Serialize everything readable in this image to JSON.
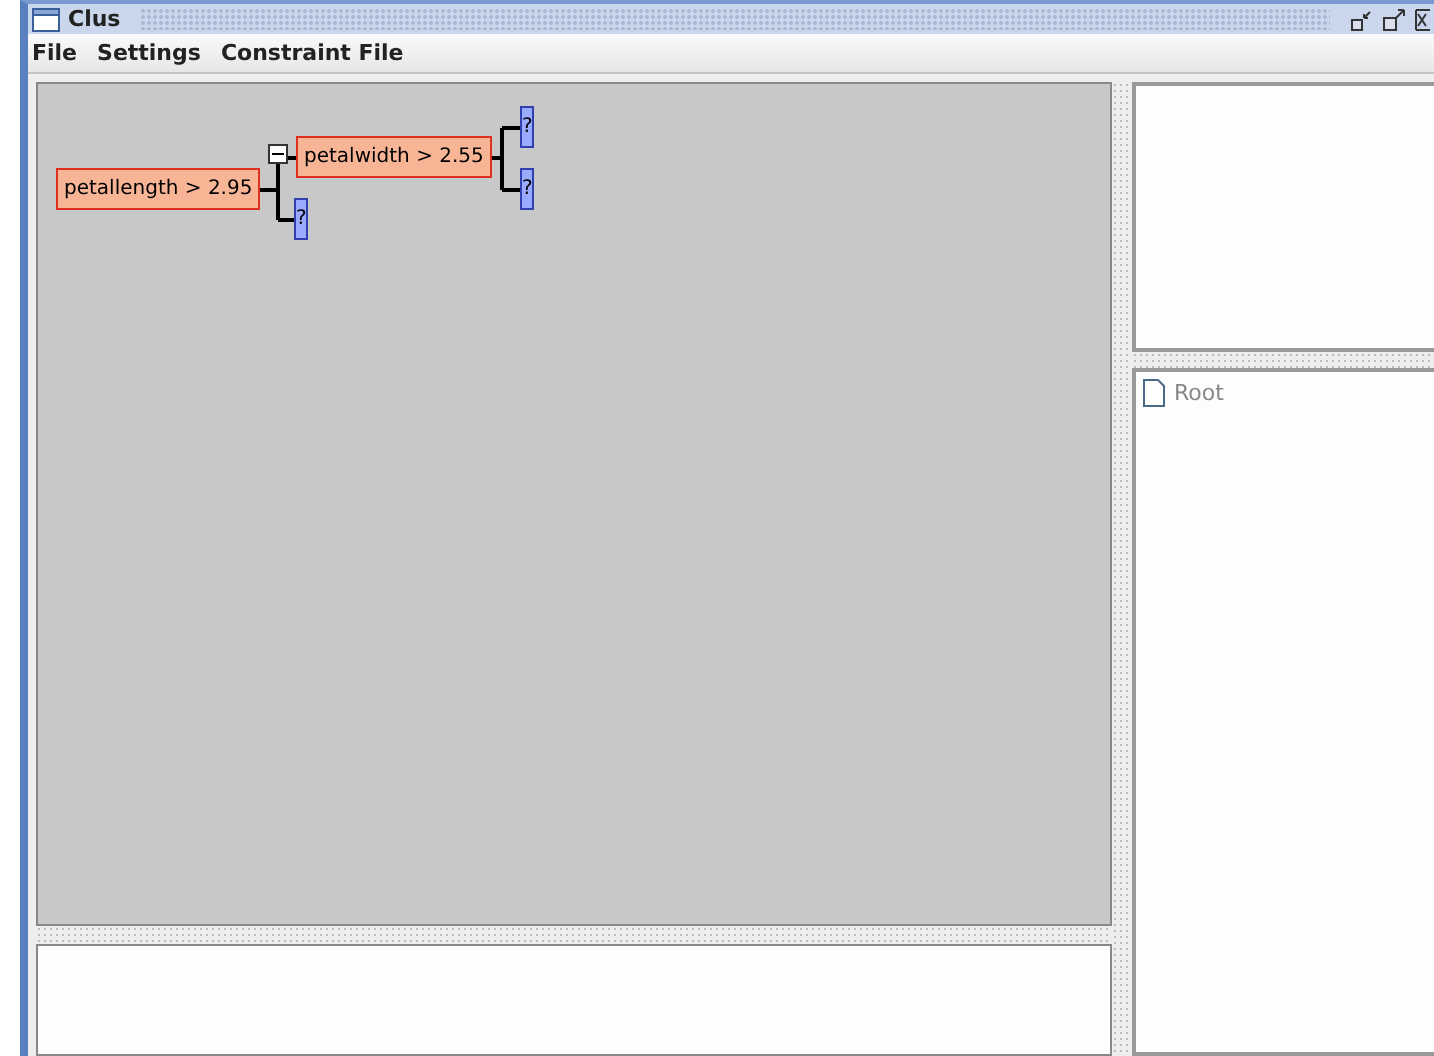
{
  "window": {
    "title": "Clus"
  },
  "menu": [
    "File",
    "Settings",
    "Constraint File"
  ],
  "tree": {
    "label": "petallength > 2.95",
    "kind": "test",
    "expanded": true,
    "children": [
      {
        "label": "petalwidth > 2.55",
        "kind": "test",
        "expanded": true,
        "children": [
          {
            "label": "?",
            "kind": "leaf"
          },
          {
            "label": "?",
            "kind": "leaf"
          }
        ]
      },
      {
        "label": "?",
        "kind": "leaf"
      }
    ]
  },
  "browser": {
    "items": [
      {
        "label": "Root"
      }
    ]
  }
}
